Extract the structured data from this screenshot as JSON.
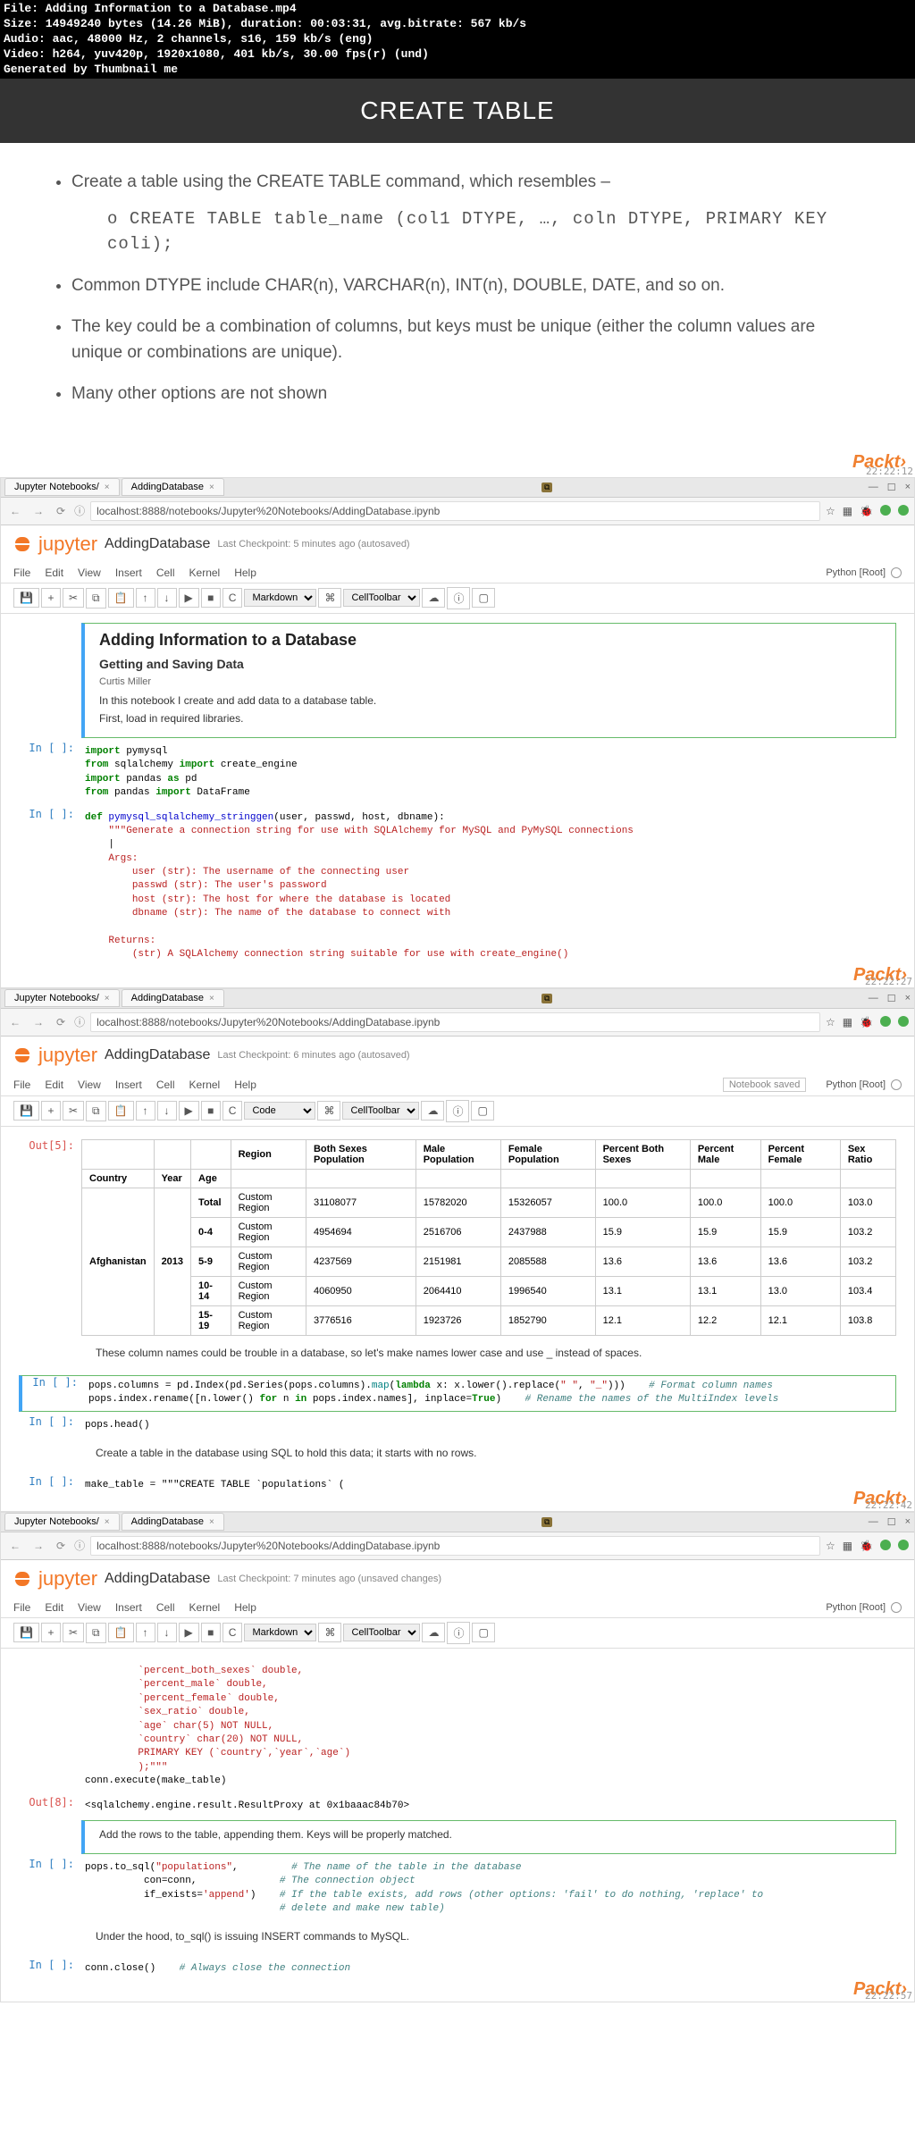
{
  "meta": {
    "line1": "File: Adding Information to a Database.mp4",
    "line2": "Size: 14949240 bytes (14.26 MiB), duration: 00:03:31, avg.bitrate: 567 kb/s",
    "line3": "Audio: aac, 48000 Hz, 2 channels, s16, 159 kb/s (eng)",
    "line4": "Video: h264, yuv420p, 1920x1080, 401 kb/s, 30.00 fps(r) (und)",
    "line5": "Generated by Thumbnail me"
  },
  "slide": {
    "title": "CREATE TABLE",
    "li1": "Create a table using the CREATE TABLE command, which resembles –",
    "li1a": "CREATE TABLE table_name (col1 DTYPE, …, coln DTYPE, PRIMARY KEY coli);",
    "li2": "Common DTYPE include CHAR(n), VARCHAR(n), INT(n), DOUBLE, DATE, and so on.",
    "li3": "The key could be a combination of columns, but keys must be unique (either the column values are unique or combinations are unique).",
    "li4": "Many other options are not shown",
    "logo": "Packt›"
  },
  "tabs": {
    "t1": "Jupyter Notebooks/",
    "t2": "AddingDatabase"
  },
  "url": "localhost:8888/notebooks/Jupyter%20Notebooks/AddingDatabase.ipynb",
  "jupyter": {
    "logo": "jupyter",
    "nbname": "AddingDatabase",
    "chk1": "Last Checkpoint: 5 minutes ago (autosaved)",
    "chk2": "Last Checkpoint: 6 minutes ago (autosaved)",
    "chk3": "Last Checkpoint: 7 minutes ago (unsaved changes)",
    "kernel": "Python [Root]",
    "saved": "Notebook saved"
  },
  "menu": {
    "file": "File",
    "edit": "Edit",
    "view": "View",
    "insert": "Insert",
    "cell": "Cell",
    "kernel": "Kernel",
    "help": "Help"
  },
  "celltype": {
    "markdown": "Markdown",
    "code": "Code"
  },
  "tlabel": {
    "celltoolbar": "CellToolbar"
  },
  "nb1": {
    "h2": "Adding Information to a Database",
    "h3": "Getting and Saving Data",
    "auth": "Curtis Miller",
    "p1": "In this notebook I create and add data to a database table.",
    "p2": "First, load in required libraries.",
    "in_label": "In [ ]:"
  },
  "nb2": {
    "out_label": "Out[5]:",
    "headers": [
      "",
      "",
      "",
      "Region",
      "Both Sexes Population",
      "Male Population",
      "Female Population",
      "Percent Both Sexes",
      "Percent Male",
      "Percent Female",
      "Sex Ratio"
    ],
    "sub_headers": [
      "Country",
      "Year",
      "Age"
    ],
    "rows": [
      [
        "Afghanistan",
        "2013",
        "Total",
        "Custom Region",
        "31108077",
        "15782020",
        "15326057",
        "100.0",
        "100.0",
        "100.0",
        "103.0"
      ],
      [
        "",
        "",
        "0-4",
        "Custom Region",
        "4954694",
        "2516706",
        "2437988",
        "15.9",
        "15.9",
        "15.9",
        "103.2"
      ],
      [
        "",
        "",
        "5-9",
        "Custom Region",
        "4237569",
        "2151981",
        "2085588",
        "13.6",
        "13.6",
        "13.6",
        "103.2"
      ],
      [
        "",
        "",
        "10-14",
        "Custom Region",
        "4060950",
        "2064410",
        "1996540",
        "13.1",
        "13.1",
        "13.0",
        "103.4"
      ],
      [
        "",
        "",
        "15-19",
        "Custom Region",
        "3776516",
        "1923726",
        "1852790",
        "12.1",
        "12.2",
        "12.1",
        "103.8"
      ]
    ],
    "note": "These column names could be trouble in a database, so let's make names lower case and use _ instead of spaces.",
    "head_call": "pops.head()",
    "table_note": "Create a table in the database using SQL to hold this data; it starts with no rows.",
    "make_table": "make_table = \"\"\"CREATE TABLE `populations` ("
  },
  "nb3": {
    "out8_label": "Out[8]:",
    "out8": "<sqlalchemy.engine.result.ResultProxy at 0x1baaac84b70>",
    "addnote": "Add the rows to the table, appending them. Keys will be properly matched.",
    "hood": "Under the hood, to_sql() is issuing INSERT commands to MySQL.",
    "close_comment": "# Always close the connection"
  },
  "timestamps": {
    "t1": "22:22:12",
    "t2": "22:22:27",
    "t3": "22:22:42",
    "t4": "22:22:57"
  }
}
